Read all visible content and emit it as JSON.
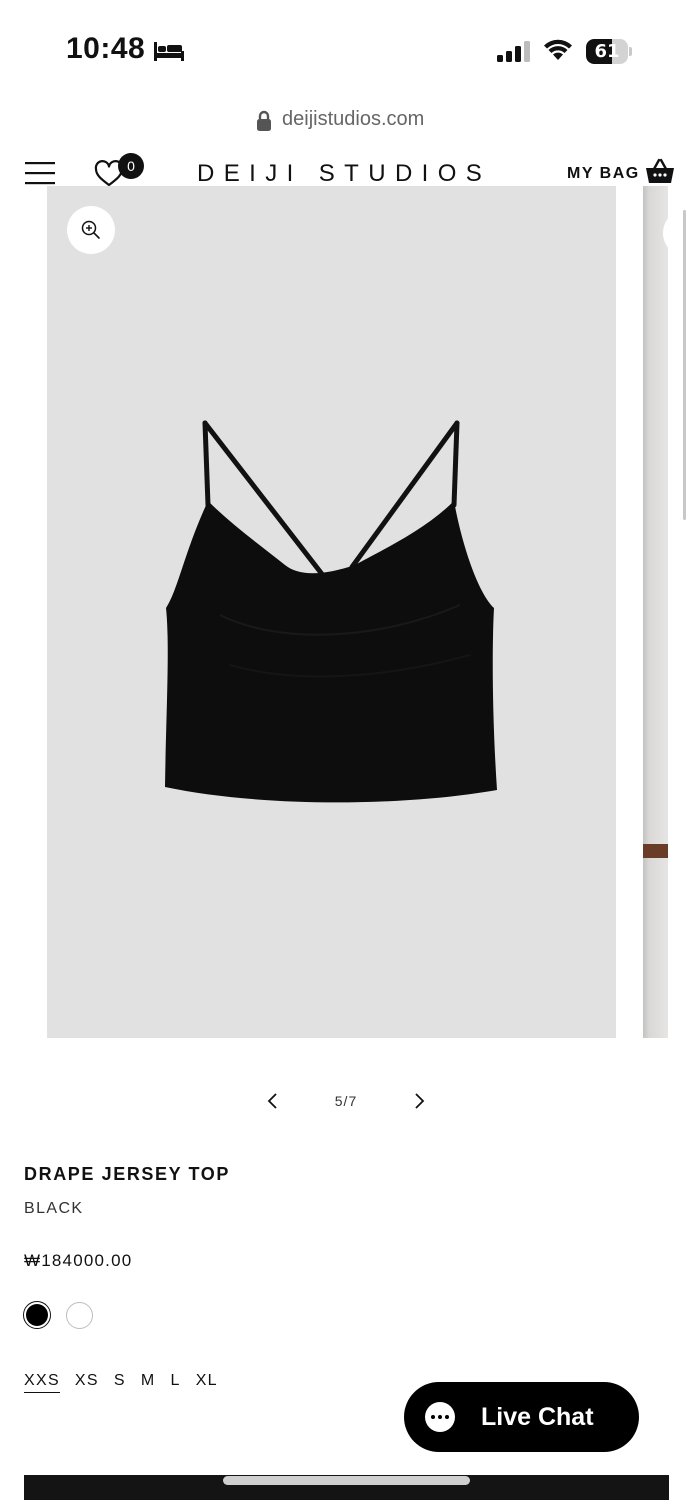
{
  "status_bar": {
    "time": "10:48",
    "battery_level": 61,
    "battery_text": "61",
    "icons": [
      "bed-icon",
      "signal-icon",
      "wifi-icon",
      "battery-icon"
    ]
  },
  "browser": {
    "url": "deijistudios.com"
  },
  "header": {
    "brand": "DEIJI STUDIOS",
    "wishlist_count": "0",
    "bag_label": "MY BAG"
  },
  "gallery": {
    "pager_text": "5/7"
  },
  "product": {
    "name": "DRAPE JERSEY TOP",
    "color": "BLACK",
    "price": "₩184000.00",
    "swatches": [
      {
        "color": "#000000",
        "selected": true
      },
      {
        "color": "#ffffff",
        "selected": false
      }
    ],
    "sizes": [
      "XXS",
      "XS",
      "S",
      "M",
      "L",
      "XL"
    ],
    "selected_size": "XXS"
  },
  "chat": {
    "label": "Live Chat"
  },
  "colors": {
    "text": "#111111",
    "photo_background": "#e1e1e1",
    "chat_background": "#000000"
  }
}
